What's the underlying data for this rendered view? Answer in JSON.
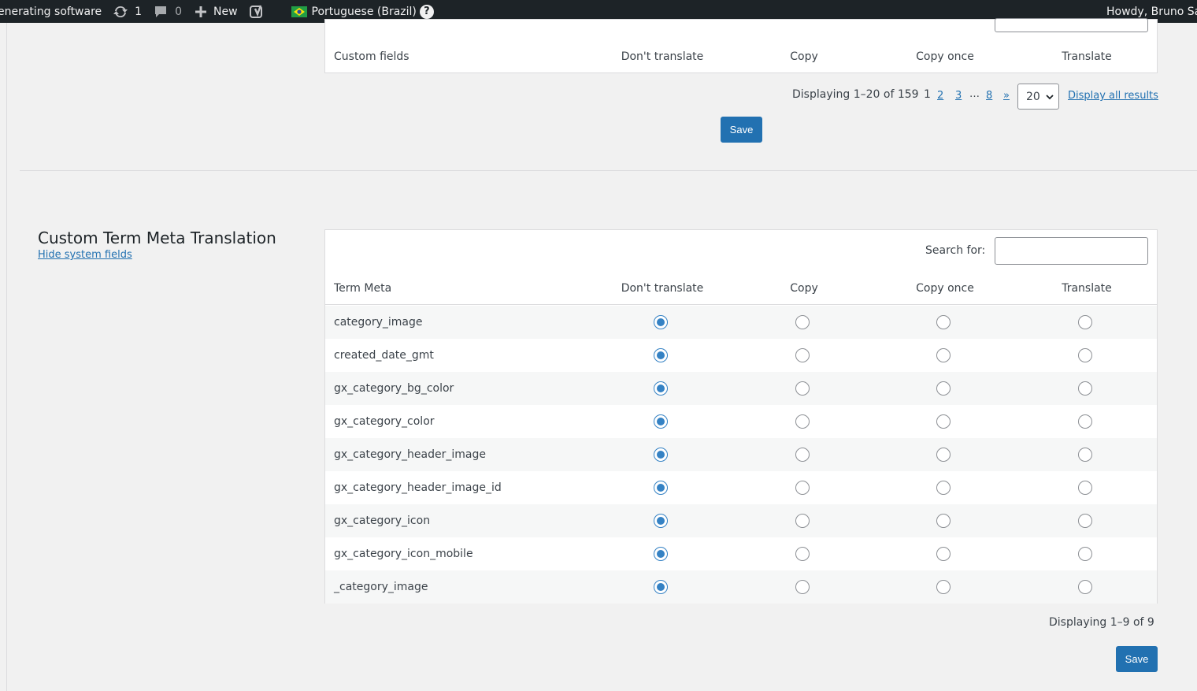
{
  "adminbar": {
    "site_name": "enerating software",
    "updates_count": "1",
    "comments_count": "0",
    "new_label": "New",
    "language": "Portuguese (Brazil)",
    "help": "?",
    "howdy": "Howdy, Bruno Sastr"
  },
  "top_section": {
    "columns": [
      "Custom fields",
      "Don't translate",
      "Copy",
      "Copy once",
      "Translate"
    ],
    "pagination": {
      "displaying": "Displaying 1–20 of 159",
      "current_page": "1",
      "pages": [
        "2",
        "3"
      ],
      "ellipsis": "…",
      "last_page": "8",
      "next": "»",
      "per_page": "20",
      "display_all": "Display all results"
    },
    "save_label": "Save"
  },
  "term_meta_section": {
    "title": "Custom Term Meta Translation",
    "hide_system_fields": "Hide system fields",
    "search_label": "Search for:",
    "search_value": "",
    "columns": [
      "Term Meta",
      "Don't translate",
      "Copy",
      "Copy once",
      "Translate"
    ],
    "rows": [
      {
        "name": "category_image",
        "selected": "dont_translate"
      },
      {
        "name": "created_date_gmt",
        "selected": "dont_translate"
      },
      {
        "name": "gx_category_bg_color",
        "selected": "dont_translate"
      },
      {
        "name": "gx_category_color",
        "selected": "dont_translate"
      },
      {
        "name": "gx_category_header_image",
        "selected": "dont_translate"
      },
      {
        "name": "gx_category_header_image_id",
        "selected": "dont_translate"
      },
      {
        "name": "gx_category_icon",
        "selected": "dont_translate"
      },
      {
        "name": "gx_category_icon_mobile",
        "selected": "dont_translate"
      },
      {
        "name": "_category_image",
        "selected": "dont_translate"
      }
    ],
    "displaying": "Displaying 1–9 of 9",
    "save_label": "Save"
  },
  "colors": {
    "adminbar_bg": "#1d2327",
    "primary": "#2271b1",
    "radio_checked": "#3582c4"
  }
}
